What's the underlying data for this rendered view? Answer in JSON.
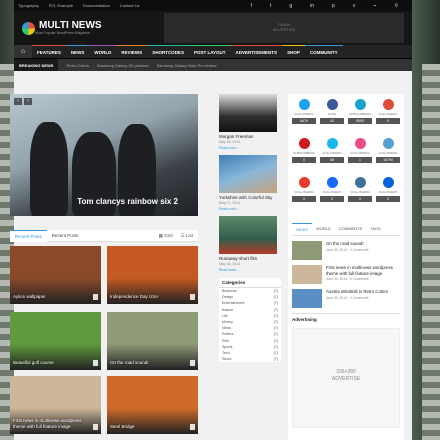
{
  "topbar": {
    "links": [
      "Typography",
      "RTL Example",
      "Documentation",
      "Contact Us"
    ]
  },
  "brand": {
    "name": "MULTI NEWS",
    "tagline": "Most Popular WordPress Magazine"
  },
  "header_ad": {
    "line1": "728x90",
    "line2": "ADVERTISE"
  },
  "nav": {
    "items": [
      "FEATURES",
      "NEWS",
      "WORLD",
      "REVIEWS",
      "SHORTCODES",
      "POST LAYOUT",
      "ADVERTISEMENTS",
      "SHOP",
      "COMMUNITY"
    ],
    "accents": [
      "#e74c3c",
      "#3498db",
      "#9b59b6",
      "#e67e22",
      "#1abc9c",
      "#2ecc71",
      "#e74c3c",
      "#f1c40f",
      "#3498db"
    ]
  },
  "breaking": {
    "label": "BREAKING NEWS",
    "items": [
      "Retro Colors",
      "Samsung Galaxy S5 pictures",
      "Samsung Galaxy Note Pro review"
    ]
  },
  "slider": {
    "caption": "Tom clancys rainbow six 2",
    "prev": "‹",
    "next": "›"
  },
  "posts_tabs": {
    "tabs": [
      "Recent Posts",
      "Recent Posts"
    ],
    "grid_label": "Grid",
    "list_label": "List"
  },
  "grid_posts": [
    {
      "title": "Aylion wallpaper",
      "bg": "#8a4a2a"
    },
    {
      "title": "Independence Day USA",
      "bg": "#c45a22"
    },
    {
      "title": "Beautiful golf course",
      "bg": "#5f9a3c"
    },
    {
      "title": "On the road sound!",
      "bg": "#8f9a76"
    },
    {
      "title": "First news in multinews wordpress theme with full feature image",
      "bg": "#cdb79a"
    },
    {
      "title": "Steel Bridge",
      "bg": "#d06a2a"
    }
  ],
  "mid_posts": [
    {
      "title": "Morgan Freeman",
      "date": "May 18, 2014",
      "more": "Read more..."
    },
    {
      "title": "Yorkshire with Colorful Sky",
      "date": "May 17, 2014",
      "more": "Read more..."
    },
    {
      "title": "Runaway short film",
      "date": "May 16, 2014",
      "more": "Read more..."
    }
  ],
  "categories": {
    "heading": "Categories",
    "items": [
      {
        "name": "Business",
        "count": "(7)"
      },
      {
        "name": "Design",
        "count": "(7)"
      },
      {
        "name": "Entertainment",
        "count": "(7)"
      },
      {
        "name": "feature",
        "count": "(7)"
      },
      {
        "name": "Life",
        "count": "(7)"
      },
      {
        "name": "Money",
        "count": "(7)"
      },
      {
        "name": "News",
        "count": "(7)"
      },
      {
        "name": "Politics",
        "count": "(7)"
      },
      {
        "name": "Rich",
        "count": "(7)"
      },
      {
        "name": "Sports",
        "count": "(7)"
      },
      {
        "name": "Tech",
        "count": "(7)"
      },
      {
        "name": "World",
        "count": "(7)"
      }
    ]
  },
  "social": [
    {
      "label": "FOLLOWERS",
      "count": "8479",
      "color": "#1da1f2",
      "icon": "twitter-icon"
    },
    {
      "label": "FANS",
      "count": "42",
      "color": "#3b5998",
      "icon": "facebook-icon"
    },
    {
      "label": "SUBSCRIBERS",
      "count": "5593",
      "color": "#1aa3c8",
      "icon": "rss-icon"
    },
    {
      "label": "FOLLOWERS",
      "count": "0",
      "color": "#dd4b39",
      "icon": "google-plus-icon"
    },
    {
      "label": "SUBSCRIBERS",
      "count": "0",
      "color": "#cc181e",
      "icon": "youtube-icon"
    },
    {
      "label": "FOLLOWERS",
      "count": "68",
      "color": "#1ab7ea",
      "icon": "vimeo-icon"
    },
    {
      "label": "FOLLOWERS",
      "count": "1",
      "color": "#ea4c89",
      "icon": "dribbble-icon"
    },
    {
      "label": "FOLLOWERS",
      "count": "16790",
      "color": "#53a0d1",
      "icon": "soundcloud-icon"
    },
    {
      "label": "FOLLOWERS",
      "count": "0",
      "color": "#e53b2c",
      "icon": "lastfm-icon"
    },
    {
      "label": "FOLLOWERS",
      "count": "0",
      "color": "#1769ff",
      "icon": "behance-icon"
    },
    {
      "label": "FOLLOWERS",
      "count": "0",
      "color": "#3f729b",
      "icon": "instagram-icon"
    },
    {
      "label": "FOLLOWERS",
      "count": "0",
      "color": "#0063dc",
      "icon": "flickr-icon"
    }
  ],
  "right_tabs": [
    "NEWS",
    "WORLD",
    "COMMENTS",
    "TAGS"
  ],
  "right_posts": [
    {
      "title": "On the road sound!",
      "date": "June 30, 2014 · 0 Comments",
      "bg": "#8f9a76"
    },
    {
      "title": "First news in multinews wordpress theme with full feature image",
      "date": "June 30, 2014 · 0 Comments",
      "bg": "#cdb79a"
    },
    {
      "title": "Austria Windmill in Retro Colors",
      "date": "June 30, 2014 · 0 Comments",
      "bg": "#5a8fc4"
    }
  ],
  "advertising": {
    "heading": "Advertising",
    "line1": "336×280",
    "line2": "ADVERTISE"
  }
}
